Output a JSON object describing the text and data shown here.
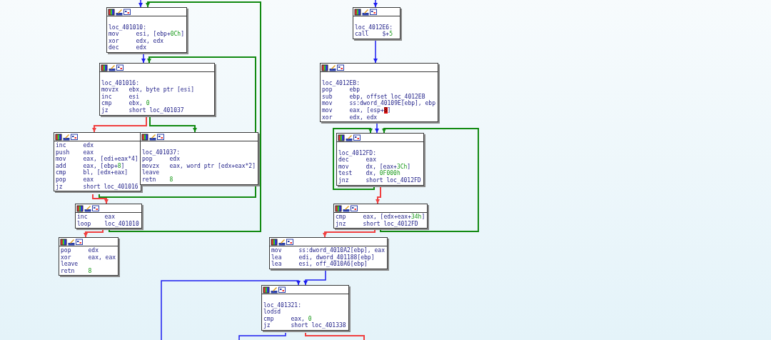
{
  "nodes": [
    {
      "label": "loc_401010:",
      "lines": [
        {
          "mnemonic": "mov",
          "operand": [
            {
              "text": "esi, [ebp+",
              "kind": "plain"
            },
            {
              "text": "0Ch",
              "kind": "number"
            },
            {
              "text": "]",
              "kind": "plain"
            }
          ]
        },
        {
          "mnemonic": "xor",
          "operand": [
            {
              "text": "edx, edx",
              "kind": "plain"
            }
          ]
        },
        {
          "mnemonic": "dec",
          "operand": [
            {
              "text": "edx",
              "kind": "plain"
            }
          ]
        }
      ]
    },
    {
      "label": "loc_401016:",
      "lines": [
        {
          "mnemonic": "movzx",
          "operand": [
            {
              "text": "ebx, byte ptr [esi]",
              "kind": "plain"
            }
          ]
        },
        {
          "mnemonic": "inc",
          "operand": [
            {
              "text": "esi",
              "kind": "plain"
            }
          ]
        },
        {
          "mnemonic": "cmp",
          "operand": [
            {
              "text": "ebx, ",
              "kind": "plain"
            },
            {
              "text": "0",
              "kind": "number"
            }
          ]
        },
        {
          "mnemonic": "jz",
          "operand": [
            {
              "text": "short loc_401037",
              "kind": "plain"
            }
          ]
        }
      ]
    },
    {
      "lines": [
        {
          "mnemonic": "inc",
          "operand": [
            {
              "text": "edx",
              "kind": "plain"
            }
          ]
        },
        {
          "mnemonic": "push",
          "operand": [
            {
              "text": "eax",
              "kind": "plain"
            }
          ]
        },
        {
          "mnemonic": "mov",
          "operand": [
            {
              "text": "eax, [edi+eax*4]",
              "kind": "plain"
            }
          ]
        },
        {
          "mnemonic": "add",
          "operand": [
            {
              "text": "eax, [ebp+",
              "kind": "plain"
            },
            {
              "text": "8",
              "kind": "number"
            },
            {
              "text": "]",
              "kind": "plain"
            }
          ]
        },
        {
          "mnemonic": "cmp",
          "operand": [
            {
              "text": "bl, [edx+eax]",
              "kind": "plain"
            }
          ]
        },
        {
          "mnemonic": "pop",
          "operand": [
            {
              "text": "eax",
              "kind": "plain"
            }
          ]
        },
        {
          "mnemonic": "jz",
          "operand": [
            {
              "text": "short loc_401016",
              "kind": "plain"
            }
          ]
        }
      ]
    },
    {
      "label": "loc_401037:",
      "lines": [
        {
          "mnemonic": "pop",
          "operand": [
            {
              "text": "edx",
              "kind": "plain"
            }
          ]
        },
        {
          "mnemonic": "movzx",
          "operand": [
            {
              "text": "eax, word ptr [edx+eax*2]",
              "kind": "plain"
            }
          ]
        },
        {
          "mnemonic": "leave"
        },
        {
          "mnemonic": "retn",
          "operand": [
            {
              "text": "8",
              "kind": "number"
            }
          ]
        }
      ]
    },
    {
      "lines": [
        {
          "mnemonic": "inc",
          "operand": [
            {
              "text": "eax",
              "kind": "plain"
            }
          ]
        },
        {
          "mnemonic": "loop",
          "operand": [
            {
              "text": "loc_401010",
              "kind": "plain"
            }
          ]
        }
      ]
    },
    {
      "lines": [
        {
          "mnemonic": "pop",
          "operand": [
            {
              "text": "edx",
              "kind": "plain"
            }
          ]
        },
        {
          "mnemonic": "xor",
          "operand": [
            {
              "text": "eax, eax",
              "kind": "plain"
            }
          ]
        },
        {
          "mnemonic": "leave"
        },
        {
          "mnemonic": "retn",
          "operand": [
            {
              "text": "8",
              "kind": "number"
            }
          ]
        }
      ]
    },
    {
      "label": "loc_4012E6:",
      "lines": [
        {
          "mnemonic": "call",
          "operand": [
            {
              "text": "$+",
              "kind": "plain"
            },
            {
              "text": "5",
              "kind": "number"
            }
          ]
        }
      ]
    },
    {
      "label": "loc_4012EB:",
      "lines": [
        {
          "mnemonic": "pop",
          "operand": [
            {
              "text": "ebp",
              "kind": "plain"
            }
          ]
        },
        {
          "mnemonic": "sub",
          "operand": [
            {
              "text": "ebp, offset loc_4012EB",
              "kind": "plain"
            }
          ]
        },
        {
          "mnemonic": "mov",
          "operand": [
            {
              "text": "ss:dword_40109E[ebp], ebp",
              "kind": "plain"
            }
          ]
        },
        {
          "mnemonic": "mov",
          "operand": [
            {
              "text": "eax, [esp+",
              "kind": "plain"
            },
            {
              "text": "8",
              "kind": "highlight"
            },
            {
              "text": "]",
              "kind": "plain"
            }
          ]
        },
        {
          "mnemonic": "xor",
          "operand": [
            {
              "text": "edx, edx",
              "kind": "plain"
            }
          ]
        }
      ]
    },
    {
      "label": "loc_4012FD:",
      "lines": [
        {
          "mnemonic": "dec",
          "operand": [
            {
              "text": "eax",
              "kind": "plain"
            }
          ]
        },
        {
          "mnemonic": "mov",
          "operand": [
            {
              "text": "dx, [eax+",
              "kind": "plain"
            },
            {
              "text": "3Ch",
              "kind": "number"
            },
            {
              "text": "]",
              "kind": "plain"
            }
          ]
        },
        {
          "mnemonic": "test",
          "operand": [
            {
              "text": "dx, ",
              "kind": "plain"
            },
            {
              "text": "0F000h",
              "kind": "number"
            }
          ]
        },
        {
          "mnemonic": "jnz",
          "operand": [
            {
              "text": "short loc_4012FD",
              "kind": "plain"
            }
          ]
        }
      ]
    },
    {
      "lines": [
        {
          "mnemonic": "cmp",
          "operand": [
            {
              "text": "eax, [edx+eax+",
              "kind": "plain"
            },
            {
              "text": "34h",
              "kind": "number"
            },
            {
              "text": "]",
              "kind": "plain"
            }
          ]
        },
        {
          "mnemonic": "jnz",
          "operand": [
            {
              "text": "short loc_4012FD",
              "kind": "plain"
            }
          ]
        }
      ]
    },
    {
      "lines": [
        {
          "mnemonic": "mov",
          "operand": [
            {
              "text": "ss:dword_4010A2[ebp], eax",
              "kind": "plain"
            }
          ]
        },
        {
          "mnemonic": "lea",
          "operand": [
            {
              "text": "edi, dword_401188[ebp]",
              "kind": "plain"
            }
          ]
        },
        {
          "mnemonic": "lea",
          "operand": [
            {
              "text": "esi, off_4010A6[ebp]",
              "kind": "plain"
            }
          ]
        }
      ]
    },
    {
      "label": "loc_401321:",
      "lines": [
        {
          "mnemonic": "lodsd"
        },
        {
          "mnemonic": "cmp",
          "operand": [
            {
              "text": "eax, ",
              "kind": "plain"
            },
            {
              "text": "0",
              "kind": "number"
            }
          ]
        },
        {
          "mnemonic": "jz",
          "operand": [
            {
              "text": "short loc_401338",
              "kind": "plain"
            }
          ]
        }
      ]
    }
  ],
  "edges": [
    {
      "kind": "flow"
    },
    {
      "kind": "true"
    },
    {
      "kind": "flow"
    },
    {
      "kind": "true"
    },
    {
      "kind": "false"
    },
    {
      "kind": "true"
    },
    {
      "kind": "false"
    },
    {
      "kind": "false"
    },
    {
      "kind": "flow"
    },
    {
      "kind": "flow"
    },
    {
      "kind": "flow"
    },
    {
      "kind": "flow"
    },
    {
      "kind": "true"
    },
    {
      "kind": "true"
    },
    {
      "kind": "false"
    },
    {
      "kind": "false"
    },
    {
      "kind": "flow"
    },
    {
      "kind": "flow"
    },
    {
      "kind": "false"
    }
  ]
}
